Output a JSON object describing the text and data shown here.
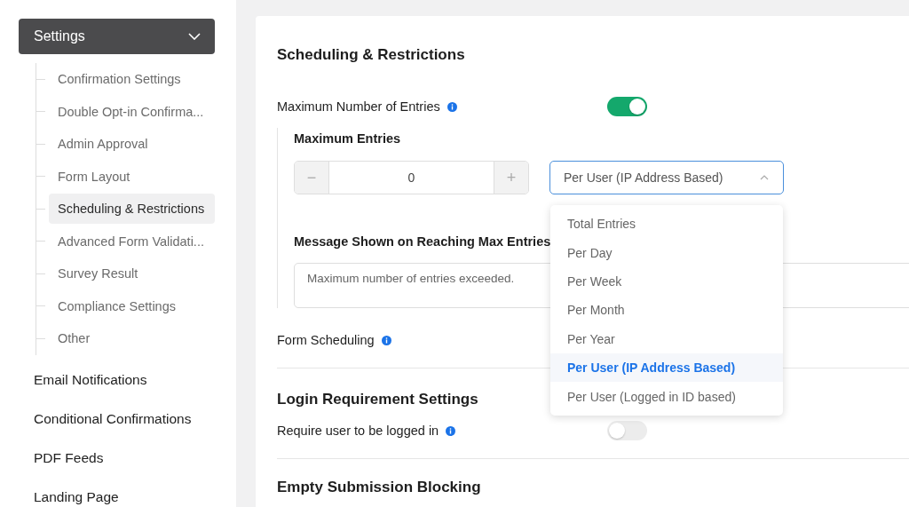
{
  "sidebar": {
    "header": {
      "label": "Settings",
      "expanded": true
    },
    "sub_items": [
      {
        "label": "Confirmation Settings",
        "selected": false
      },
      {
        "label": "Double Opt-in Confirma...",
        "selected": false
      },
      {
        "label": "Admin Approval",
        "selected": false
      },
      {
        "label": "Form Layout",
        "selected": false
      },
      {
        "label": "Scheduling & Restrictions",
        "selected": true
      },
      {
        "label": "Advanced Form Validati...",
        "selected": false
      },
      {
        "label": "Survey Result",
        "selected": false
      },
      {
        "label": "Compliance Settings",
        "selected": false
      },
      {
        "label": "Other",
        "selected": false
      }
    ],
    "items": [
      {
        "label": "Email Notifications"
      },
      {
        "label": "Conditional Confirmations"
      },
      {
        "label": "PDF Feeds"
      },
      {
        "label": "Landing Page"
      }
    ]
  },
  "main": {
    "title": "Scheduling & Restrictions",
    "max_entries": {
      "label": "Maximum Number of Entries",
      "on": true,
      "field_label": "Maximum Entries",
      "minus": "−",
      "value": "0",
      "plus": "+",
      "select": {
        "value": "Per User (IP Address Based)",
        "expanded": true,
        "options": [
          {
            "label": "Total Entries",
            "selected": false
          },
          {
            "label": "Per Day",
            "selected": false
          },
          {
            "label": "Per Week",
            "selected": false
          },
          {
            "label": "Per Month",
            "selected": false
          },
          {
            "label": "Per Year",
            "selected": false
          },
          {
            "label": "Per User (IP Address Based)",
            "selected": true
          },
          {
            "label": "Per User (Logged in ID based)",
            "selected": false
          }
        ]
      },
      "message_label": "Message Shown on Reaching Max Entries",
      "message": "Maximum number of entries exceeded."
    },
    "form_scheduling": {
      "label": "Form Scheduling"
    },
    "login": {
      "title": "Login Requirement Settings",
      "label": "Require user to be logged in",
      "on": false
    },
    "empty": {
      "title": "Empty Submission Blocking"
    }
  }
}
